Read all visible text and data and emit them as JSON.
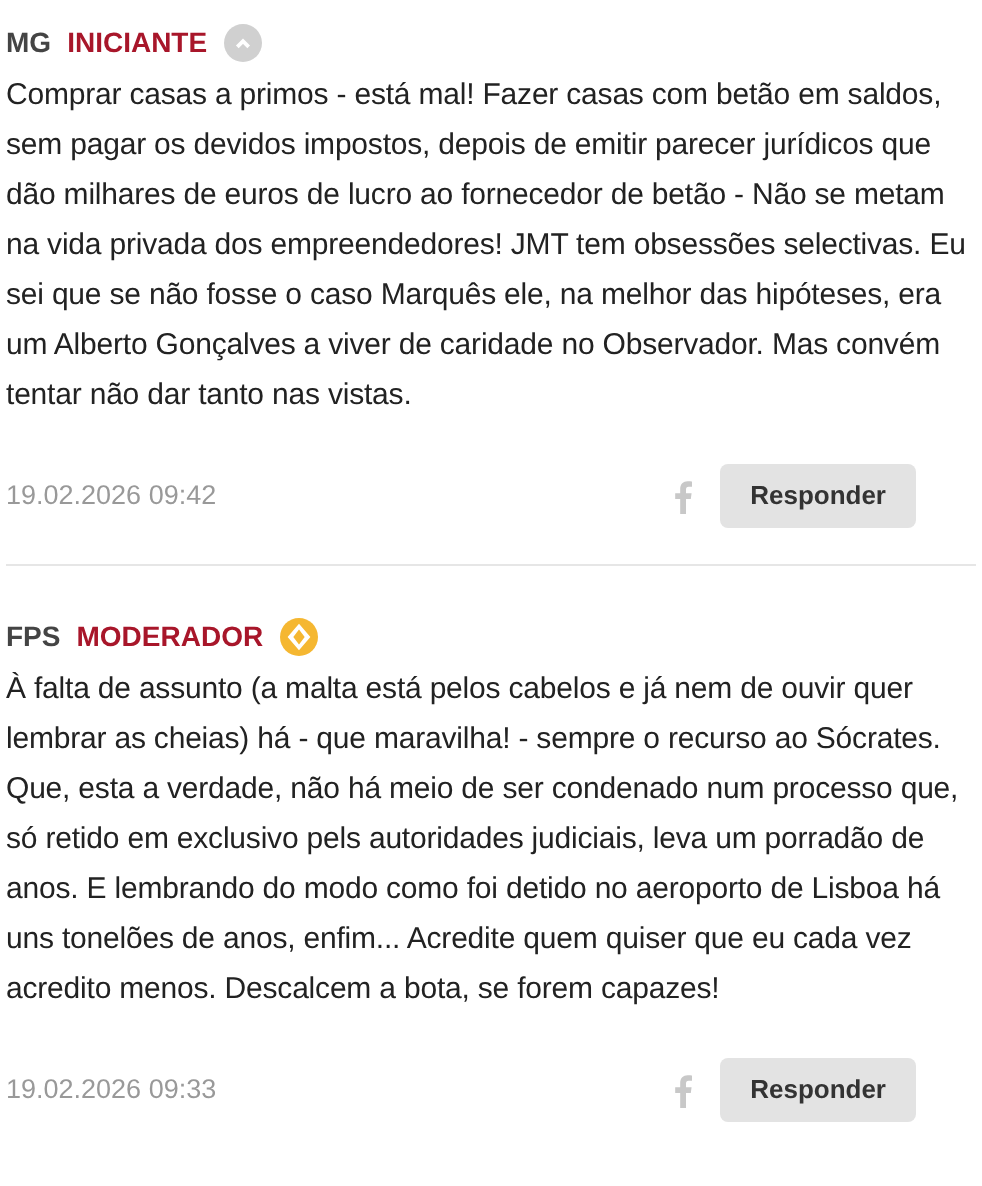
{
  "comments": [
    {
      "author": "MG",
      "rank": "INICIANTE",
      "kind": "iniciante",
      "text": "Comprar casas a primos - está mal! Fazer casas com betão em saldos, sem pagar os devidos impostos, depois de emitir parecer jurídicos que dão milhares de euros de lucro ao fornecedor de betão - Não se metam na vida privada dos empreendedores! JMT tem obsessões selectivas. Eu sei que se não fosse o caso Marquês ele, na melhor das hipóteses, era um Alberto Gonçalves a viver de caridade no Observador. Mas convém tentar não dar tanto nas vistas.",
      "date": "19.02.2026 09:42",
      "reply": "Responder"
    },
    {
      "author": "FPS",
      "rank": "MODERADOR",
      "kind": "moderador",
      "text": "À falta de assunto (a malta está pelos cabelos e já nem de ouvir quer lembrar as cheias) há - que maravilha! - sempre o recurso ao Sócrates. Que, esta a verdade, não há meio de ser condenado num processo que, só retido em exclusivo pels autoridades judiciais, leva um porradão de anos. E lembrando do modo como foi detido no aeroporto de Lisboa há uns tonelões de anos, enfim... Acredite quem quiser que eu cada vez acredito menos. Descalcem a bota, se forem capazes!",
      "date": "19.02.2026 09:33",
      "reply": "Responder"
    }
  ]
}
